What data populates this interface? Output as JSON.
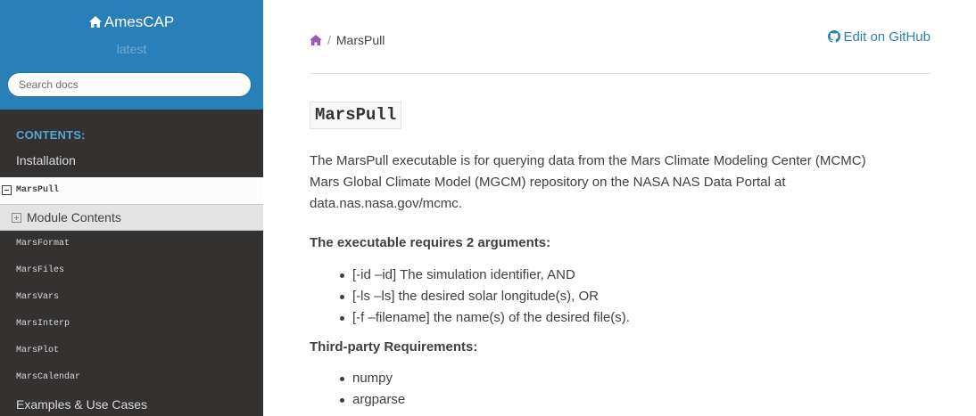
{
  "sidebar": {
    "project": "AmesCAP",
    "version": "latest",
    "search_placeholder": "Search docs",
    "caption": "CONTENTS:",
    "items": {
      "installation": "Installation",
      "current": "MarsPull",
      "module_contents": "Module Contents",
      "marsformat": "MarsFormat",
      "marsfiles": "MarsFiles",
      "marsvars": "MarsVars",
      "marsinterp": "MarsInterp",
      "marsplot": "MarsPlot",
      "marscalendar": "MarsCalendar",
      "examples": "Examples & Use Cases"
    }
  },
  "breadcrumb": {
    "separator": "/",
    "current": "MarsPull"
  },
  "edit_link": "Edit on GitHub",
  "page": {
    "title": "MarsPull",
    "description_lines": [
      "The MarsPull executable is for querying data from the Mars Climate Modeling Center (MCMC)",
      "Mars Global Climate Model (MGCM) repository on the NASA NAS Data Portal at",
      "data.nas.nasa.gov/mcmc."
    ],
    "args_heading": "The executable requires 2 arguments:",
    "args": [
      "[-id –id] The simulation identifier, AND",
      "[-ls –ls] the desired solar longitude(s), OR",
      "[-f –filename] the name(s) of the desired file(s)."
    ],
    "req_heading": "Third-party Requirements:",
    "requirements": [
      "numpy",
      "argparse"
    ]
  },
  "colors": {
    "sidebar_top": "#2980b9",
    "sidebar_bg": "#343131",
    "caption": "#55a5d9",
    "link": "#2980b9",
    "breadcrumb_home": "#9b59b6"
  },
  "icons": {
    "brand": "home-icon",
    "breadcrumb": "home-icon",
    "edit": "github-icon"
  }
}
